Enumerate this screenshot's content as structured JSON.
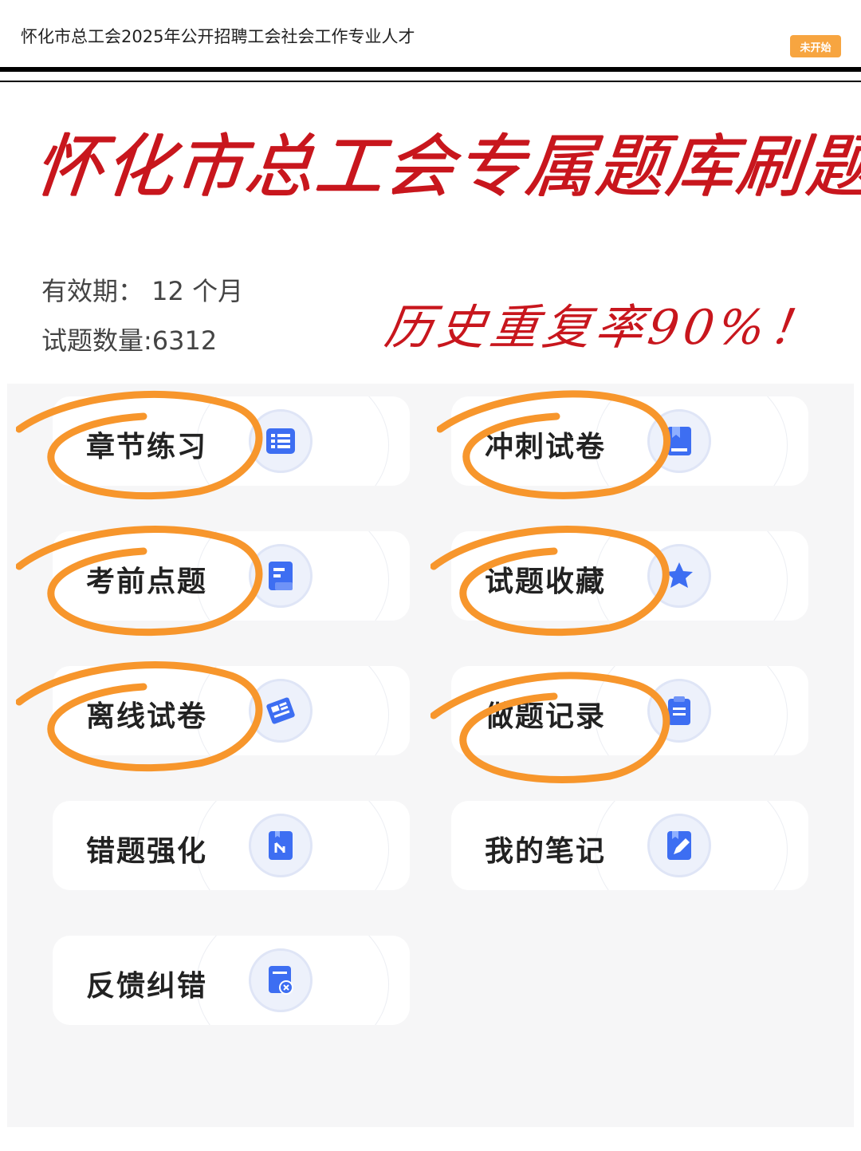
{
  "header": {
    "title": "怀化市总工会2025年公开招聘工会社会工作专业人才",
    "status_badge": "未开始"
  },
  "headline": "怀化市总工会专属题库刷题",
  "info": {
    "validity": "有效期： 12 个月",
    "question_count": "试题数量:6312"
  },
  "tagline": "历史重复率90%！",
  "menu": [
    {
      "label": "章节练习",
      "icon": "list-icon",
      "circled": true
    },
    {
      "label": "冲刺试卷",
      "icon": "bookmark-icon",
      "circled": true
    },
    {
      "label": "考前点题",
      "icon": "document-icon",
      "circled": true
    },
    {
      "label": "试题收藏",
      "icon": "star-icon",
      "circled": true
    },
    {
      "label": "离线试卷",
      "icon": "download-paper-icon",
      "circled": true
    },
    {
      "label": "做题记录",
      "icon": "clipboard-icon",
      "circled": true
    },
    {
      "label": "错题强化",
      "icon": "bookmark-branch-icon",
      "circled": false
    },
    {
      "label": "我的笔记",
      "icon": "note-edit-icon",
      "circled": false
    },
    {
      "label": "反馈纠错",
      "icon": "feedback-error-icon",
      "circled": false
    }
  ],
  "colors": {
    "accent_red": "#c8161d",
    "badge_orange": "#f7a540",
    "circle_orange": "#f7962c",
    "icon_blue": "#3d6ef2"
  }
}
